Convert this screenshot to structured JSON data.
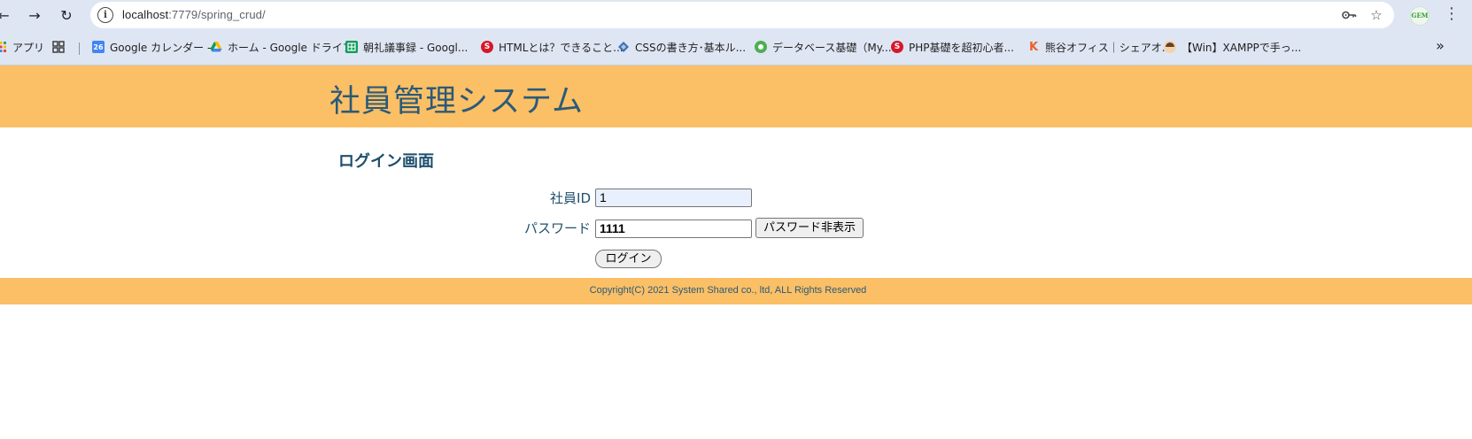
{
  "browser": {
    "url_host": "localhost",
    "url_path": ":7779/spring_crud/",
    "profile_label": "GEM",
    "bookmarks": [
      {
        "label": "アプリ",
        "icon": "apps-grid-icon",
        "color": "#ea4335"
      },
      {
        "label": "",
        "icon": "grid-icon",
        "color": "#444444"
      },
      {
        "label": "Google カレンダー -",
        "icon": "calendar-icon",
        "color": "#4285f4"
      },
      {
        "label": "ホーム - Google ドライブ",
        "icon": "drive-icon",
        "color": "#0f9d58"
      },
      {
        "label": "朝礼議事録 - Googl...",
        "icon": "sheets-icon",
        "color": "#0f9d58"
      },
      {
        "label": "HTMLとは？できること...",
        "icon": "red-circle-icon",
        "color": "#d7182a"
      },
      {
        "label": "CSSの書き方･基本ル...",
        "icon": "diamond-icon",
        "color": "#3f6fb5"
      },
      {
        "label": "データベース基礎（My...",
        "icon": "green-circle-icon",
        "color": "#4caf50"
      },
      {
        "label": "PHP基礎を超初心者...",
        "icon": "red-circle-icon",
        "color": "#d7182a"
      },
      {
        "label": "熊谷オフィス｜シェアオ...",
        "icon": "k-icon",
        "color": "#e8632c"
      },
      {
        "label": "【Win】XAMPPで手っ...",
        "icon": "avatar-icon",
        "color": "#7a4b2a"
      }
    ]
  },
  "page": {
    "site_title": "社員管理システム",
    "heading": "ログイン画面",
    "form": {
      "id_label": "社員ID",
      "id_value": "1",
      "password_label": "パスワード",
      "password_value": "1111",
      "toggle_button": "パスワード非表示",
      "login_button": "ログイン"
    },
    "footer": "Copyright(C) 2021 System Shared co., ltd, ALL Rights Reserved"
  },
  "colors": {
    "header_bg": "#fbbf66",
    "text_accent": "#1e4f6c",
    "browser_chrome": "#dfe6f3"
  }
}
